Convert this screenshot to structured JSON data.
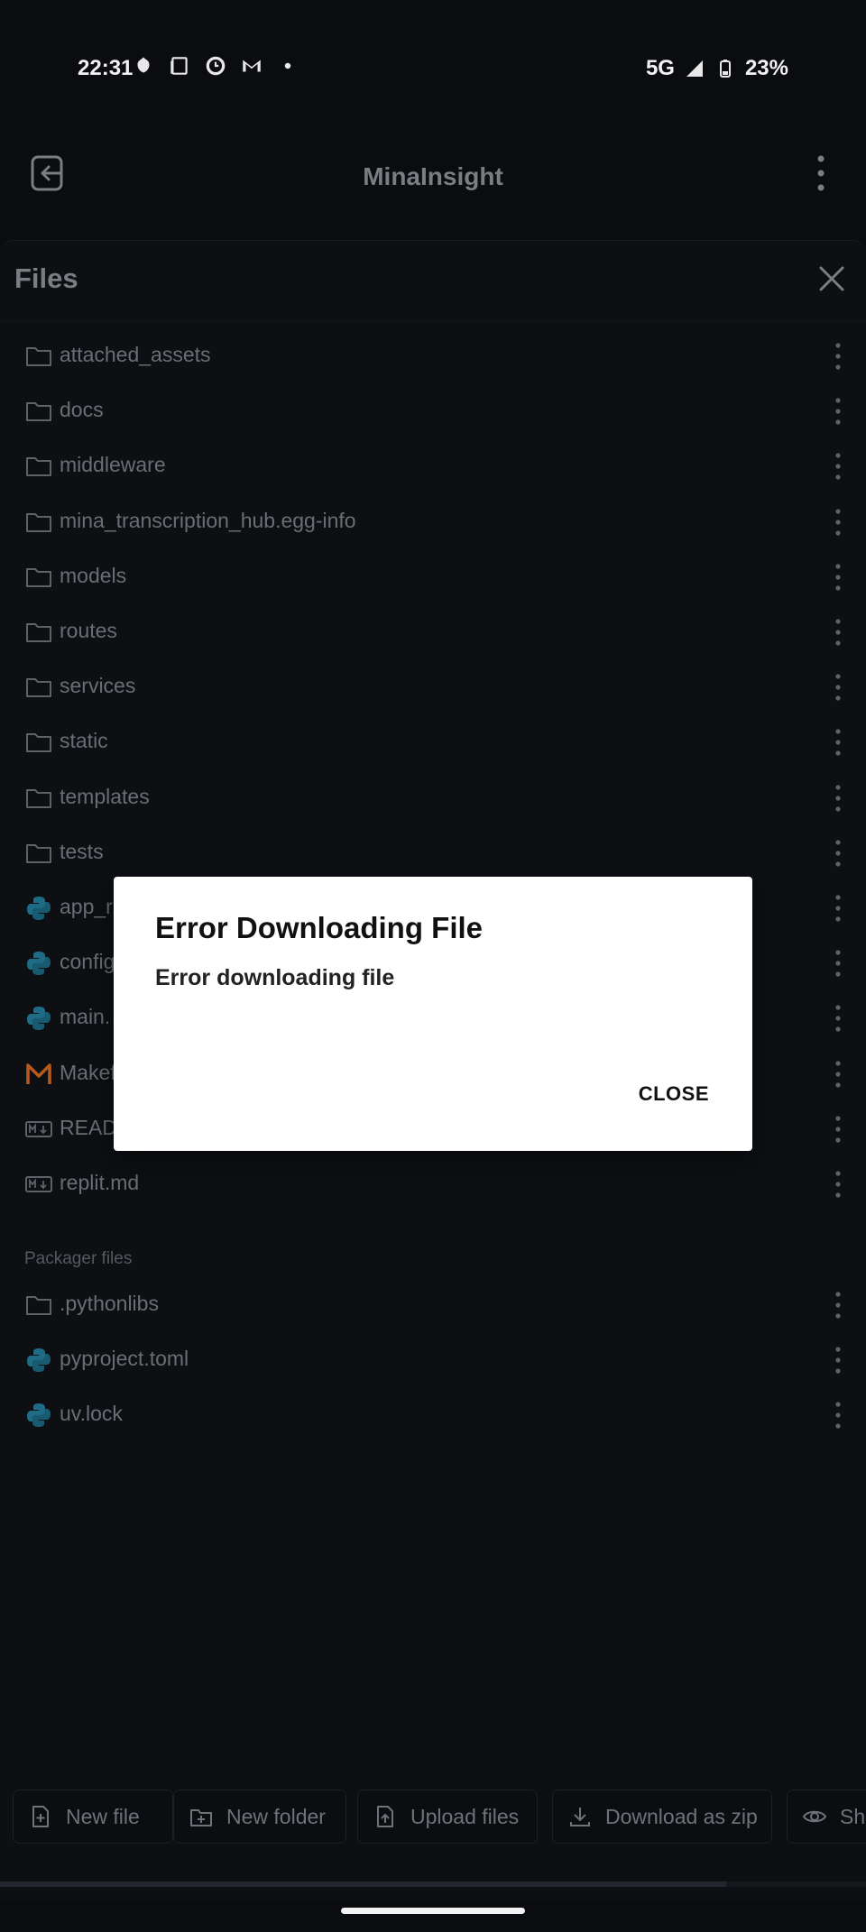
{
  "status_bar": {
    "time": "22:31",
    "network": "5G",
    "battery": "23%",
    "left_icons": [
      "app-notification-icon",
      "document-icon",
      "clock-icon",
      "gmail-icon",
      "dot-icon"
    ],
    "right_icons": [
      "signal-icon",
      "battery-icon"
    ]
  },
  "header": {
    "title": "MinaInsight",
    "back_icon": "exit-icon",
    "menu_icon": "kebab-menu-icon"
  },
  "files_panel": {
    "title": "Files",
    "close_icon": "close-icon",
    "items": [
      {
        "label": "attached_assets",
        "icon": "folder-icon"
      },
      {
        "label": "docs",
        "icon": "folder-icon"
      },
      {
        "label": "middleware",
        "icon": "folder-icon"
      },
      {
        "label": "mina_transcription_hub.egg-info",
        "icon": "folder-icon"
      },
      {
        "label": "models",
        "icon": "folder-icon"
      },
      {
        "label": "routes",
        "icon": "folder-icon"
      },
      {
        "label": "services",
        "icon": "folder-icon"
      },
      {
        "label": "static",
        "icon": "folder-icon"
      },
      {
        "label": "templates",
        "icon": "folder-icon"
      },
      {
        "label": "tests",
        "icon": "folder-icon"
      },
      {
        "label": "app_r",
        "icon": "python-icon"
      },
      {
        "label": "config",
        "icon": "python-icon"
      },
      {
        "label": "main.",
        "icon": "python-icon"
      },
      {
        "label": "Makef",
        "icon": "makefile-icon"
      },
      {
        "label": "READ",
        "icon": "markdown-icon"
      },
      {
        "label": "replit.md",
        "icon": "markdown-icon"
      }
    ],
    "packager_section_label": "Packager files",
    "packager_items": [
      {
        "label": ".pythonlibs",
        "icon": "folder-icon"
      },
      {
        "label": "pyproject.toml",
        "icon": "python-icon"
      },
      {
        "label": "uv.lock",
        "icon": "python-icon"
      }
    ]
  },
  "toolbar": {
    "new_file": "New file",
    "new_folder": "New folder",
    "upload_files": "Upload files",
    "download_zip": "Download as zip",
    "show": "Sh"
  },
  "dialog": {
    "title": "Error Downloading File",
    "message": "Error downloading file",
    "close_label": "CLOSE"
  },
  "colors": {
    "background": "#0b0c10",
    "dim_text": "#6a6e74",
    "python_blue": "#1d6b85",
    "makefile_orange": "#b65a1e",
    "dialog_bg": "#ffffff"
  }
}
